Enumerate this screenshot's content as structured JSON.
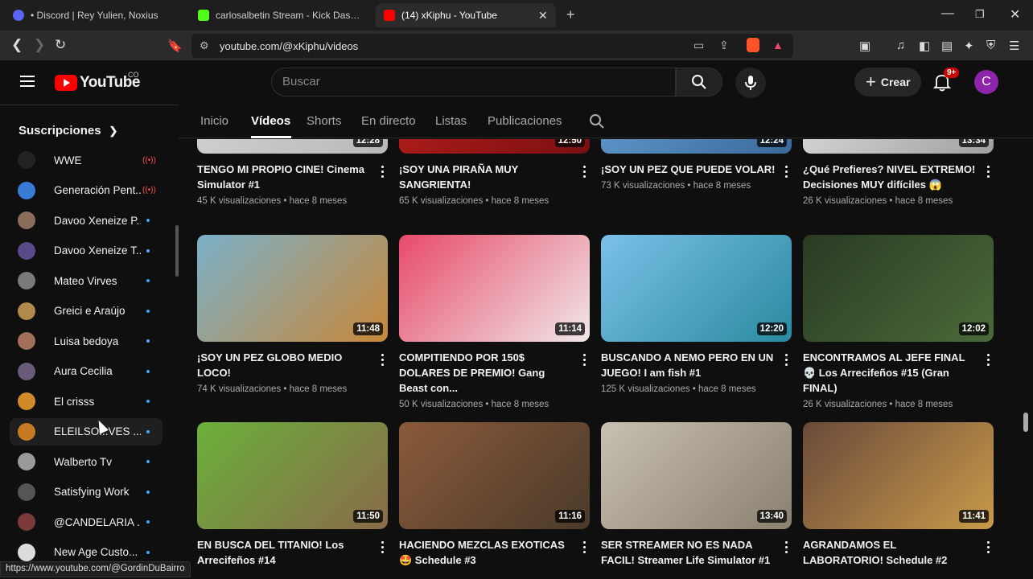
{
  "browser": {
    "tabs": [
      {
        "title": "• Discord | Rey Yulien, Noxius",
        "fav_color": "#5865F2"
      },
      {
        "title": "carlosalbetin Stream - Kick Dashboard",
        "fav_color": "#53fc18"
      },
      {
        "title": "(14) xKiphu - YouTube",
        "fav_color": "#ff0000"
      }
    ],
    "new_tab": "+",
    "url": "youtube.com/@xKiphu/videos",
    "status_url": "https://www.youtube.com/@GordinDuBairro"
  },
  "header": {
    "logo_text": "YouTube",
    "logo_region": "CO",
    "search_placeholder": "Buscar",
    "create_label": "Crear",
    "notif_badge": "9+",
    "avatar_letter": "C"
  },
  "sidebar": {
    "title": "Suscripciones",
    "items": [
      {
        "name": "WWE",
        "live": true,
        "color": "#222"
      },
      {
        "name": "Generación Pent...",
        "live": true,
        "color": "#3a7bd5"
      },
      {
        "name": "Davoo Xeneize P...",
        "live": false,
        "color": "#8b6d5c"
      },
      {
        "name": "Davoo Xeneize T...",
        "live": false,
        "color": "#5b4a8a"
      },
      {
        "name": "Mateo Virves",
        "live": false,
        "color": "#7a7a7a"
      },
      {
        "name": "Greici e Araújo",
        "live": false,
        "color": "#b08a4a"
      },
      {
        "name": "Luisa bedoya",
        "live": false,
        "color": "#a0705a"
      },
      {
        "name": "Aura Cecilia",
        "live": false,
        "color": "#6a5a7a"
      },
      {
        "name": "El crisss",
        "live": false,
        "color": "#d08a2a"
      },
      {
        "name": "ELEILSO...VES ...",
        "live": false,
        "color": "#c77a22"
      },
      {
        "name": "Walberto Tv",
        "live": false,
        "color": "#9a9a9a"
      },
      {
        "name": "Satisfying Work",
        "live": false,
        "color": "#555"
      },
      {
        "name": "@CANDELARIA ...",
        "live": false,
        "color": "#7a3a3a"
      },
      {
        "name": "New Age Custo...",
        "live": false,
        "color": "#dcdcdc"
      }
    ]
  },
  "channel_tabs": [
    "Inicio",
    "Vídeos",
    "Shorts",
    "En directo",
    "Listas",
    "Publicaciones"
  ],
  "videos": [
    {
      "title": "TENGO MI PROPIO CINE! Cinema Simulator #1",
      "meta": "45 K visualizaciones • hace 8 meses",
      "duration": "12:28",
      "thumb": [
        "#d8d8d8",
        "#b8b8b8"
      ]
    },
    {
      "title": "¡SOY UNA PIRAÑA MUY SANGRIENTA!",
      "meta": "65 K visualizaciones • hace 8 meses",
      "duration": "12:50",
      "thumb": [
        "#c0201e",
        "#7a1010"
      ]
    },
    {
      "title": "¡SOY UN PEZ QUE PUEDE VOLAR!",
      "meta": "73 K visualizaciones • hace 8 meses",
      "duration": "12:24",
      "thumb": [
        "#6aa4d8",
        "#3a6a9a"
      ]
    },
    {
      "title": "¿Qué Prefieres? NIVEL EXTREMO! Decisiones MUY difíciles 😱",
      "meta": "26 K visualizaciones • hace 8 meses",
      "duration": "13:34",
      "thumb": [
        "#e8e8e8",
        "#a0a0a0"
      ]
    },
    {
      "title": "¡SOY UN PEZ GLOBO MEDIO LOCO!",
      "meta": "74 K visualizaciones • hace 8 meses",
      "duration": "11:48",
      "thumb": [
        "#7ab0c8",
        "#c8883a"
      ]
    },
    {
      "title": "COMPITIENDO POR 150$ DOLARES DE PREMIO! Gang Beast con...",
      "meta": "50 K visualizaciones • hace 8 meses",
      "duration": "11:14",
      "thumb": [
        "#e84a6a",
        "#f0e8e8"
      ]
    },
    {
      "title": "BUSCANDO A NEMO PERO EN UN JUEGO! I am fish #1",
      "meta": "125 K visualizaciones • hace 8 meses",
      "duration": "12:20",
      "thumb": [
        "#7ac0e8",
        "#2a8aa0"
      ]
    },
    {
      "title": "ENCONTRAMOS AL JEFE FINAL 💀 Los Arrecifeños #15 (Gran FINAL)",
      "meta": "26 K visualizaciones • hace 8 meses",
      "duration": "12:02",
      "thumb": [
        "#2a3a22",
        "#4a6a3a"
      ]
    },
    {
      "title": "EN BUSCA DEL TITANIO! Los Arrecifeños #14",
      "meta": "",
      "duration": "11:50",
      "thumb": [
        "#6ab03a",
        "#8a6a4a"
      ]
    },
    {
      "title": "HACIENDO MEZCLAS EXOTICAS 🤩 Schedule #3",
      "meta": "",
      "duration": "11:16",
      "thumb": [
        "#8a5a3a",
        "#4a3a2a"
      ]
    },
    {
      "title": "SER STREAMER NO ES NADA FACIL! Streamer Life Simulator #1",
      "meta": "",
      "duration": "13:40",
      "thumb": [
        "#c8c0b0",
        "#8a8070"
      ]
    },
    {
      "title": "AGRANDAMOS EL LABORATORIO! Schedule #2",
      "meta": "",
      "duration": "11:41",
      "thumb": [
        "#6a4a3a",
        "#c89a4a"
      ]
    }
  ]
}
